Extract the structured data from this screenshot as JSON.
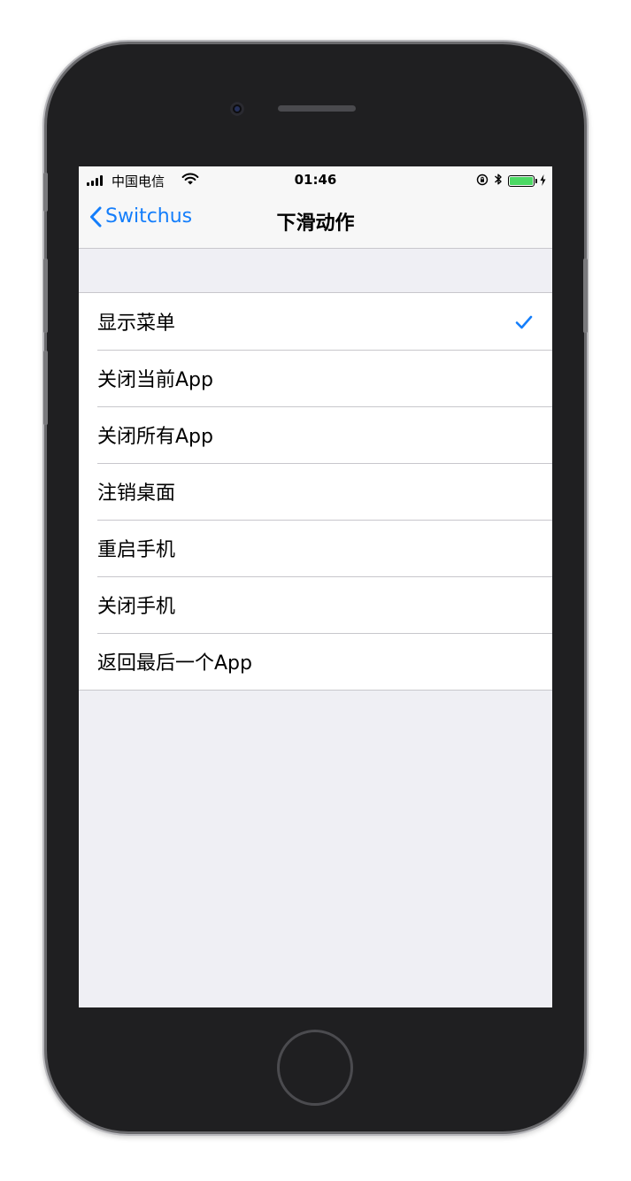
{
  "status_bar": {
    "carrier": "中国电信",
    "time": "01:46",
    "signal_icon": "signal-bars-icon",
    "wifi_icon": "wifi-icon",
    "orientation_lock_icon": "orientation-lock-icon",
    "bluetooth_icon": "bluetooth-icon",
    "battery_icon": "battery-icon",
    "charging_icon": "charging-bolt-icon",
    "battery_level": 1.0,
    "battery_color": "#4cd964"
  },
  "nav": {
    "back_label": "Switchus",
    "title": "下滑动作",
    "accent_color": "#147efb"
  },
  "options": {
    "selected_index": 0,
    "items": [
      {
        "label": "显示菜单",
        "checked": true
      },
      {
        "label": "关闭当前App",
        "checked": false
      },
      {
        "label": "关闭所有App",
        "checked": false
      },
      {
        "label": "注销桌面",
        "checked": false
      },
      {
        "label": "重启手机",
        "checked": false
      },
      {
        "label": "关闭手机",
        "checked": false
      },
      {
        "label": "返回最后一个App",
        "checked": false
      }
    ]
  }
}
